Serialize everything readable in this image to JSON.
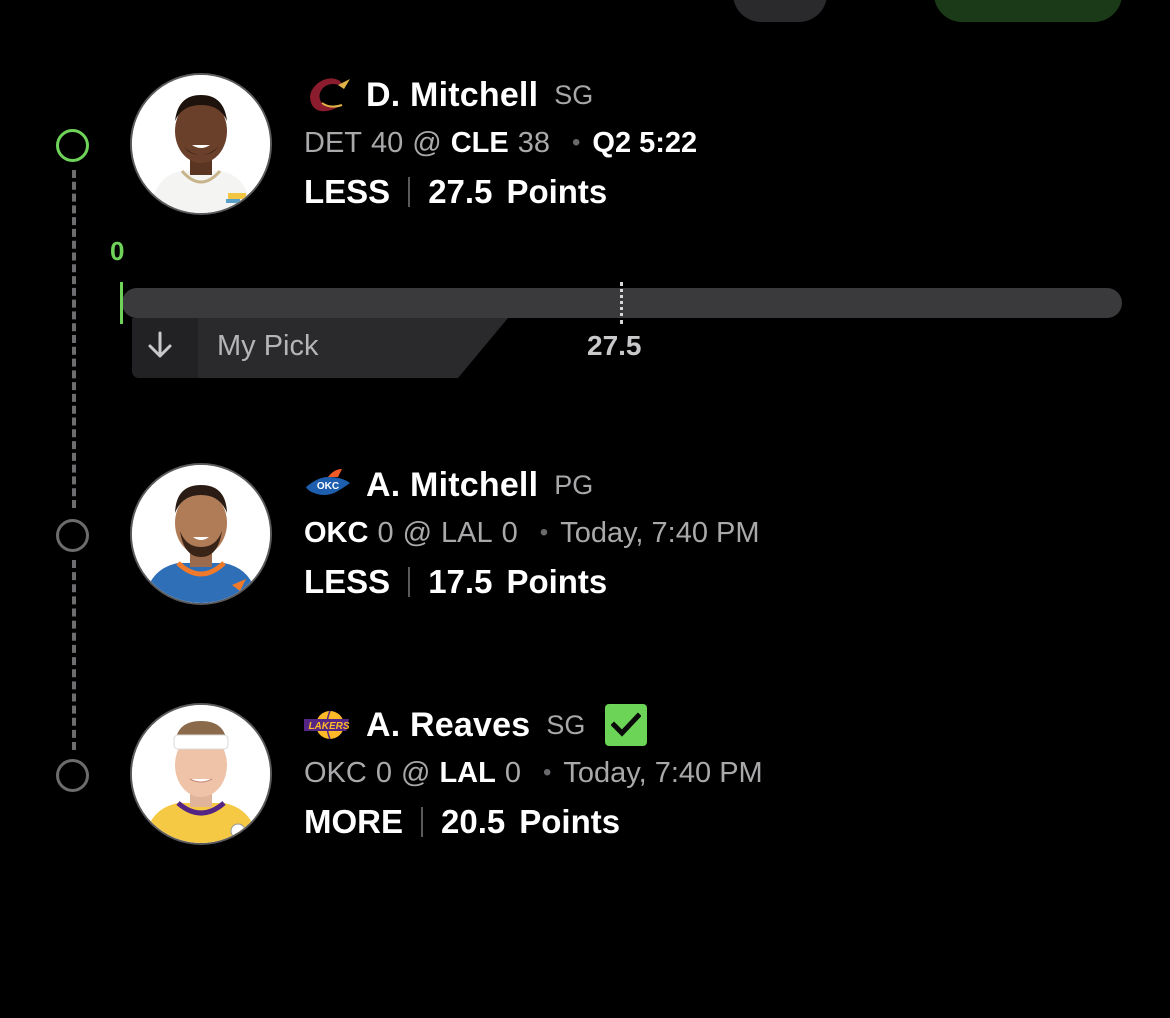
{
  "colors": {
    "background": "#000000",
    "accent_green": "#6fd35a",
    "timeline_gray": "#6e6e70",
    "track_gray": "#3a3a3c",
    "tag_gray": "#2a2a2c"
  },
  "picks": [
    {
      "team_logo_icon": "cavaliers-c-logo-icon",
      "name": "D. Mitchell",
      "position": "SG",
      "game": {
        "away": "DET",
        "away_score": "40",
        "at": "@",
        "home": "CLE",
        "home_score": "38",
        "bold_team": "home",
        "status": "Q2 5:22",
        "live": true
      },
      "pick": {
        "direction": "LESS",
        "line": "27.5",
        "stat": "Points"
      },
      "checked": false
    },
    {
      "team_logo_icon": "thunder-okc-logo-icon",
      "name": "A. Mitchell",
      "position": "PG",
      "game": {
        "away": "OKC",
        "away_score": "0",
        "at": "@",
        "home": "LAL",
        "home_score": "0",
        "bold_team": "away",
        "status": "Today, 7:40 PM",
        "live": false
      },
      "pick": {
        "direction": "LESS",
        "line": "17.5",
        "stat": "Points"
      },
      "checked": false
    },
    {
      "team_logo_icon": "lakers-logo-icon",
      "name": "A. Reaves",
      "position": "SG",
      "game": {
        "away": "OKC",
        "away_score": "0",
        "at": "@",
        "home": "LAL",
        "home_score": "0",
        "bold_team": "home",
        "status": "Today, 7:40 PM",
        "live": false
      },
      "pick": {
        "direction": "MORE",
        "line": "20.5",
        "stat": "Points"
      },
      "checked": true
    }
  ],
  "progress": {
    "current_value": "0",
    "line_value": "27.5",
    "tag_icon": "arrow-down-icon",
    "tag_label": "My Pick"
  }
}
